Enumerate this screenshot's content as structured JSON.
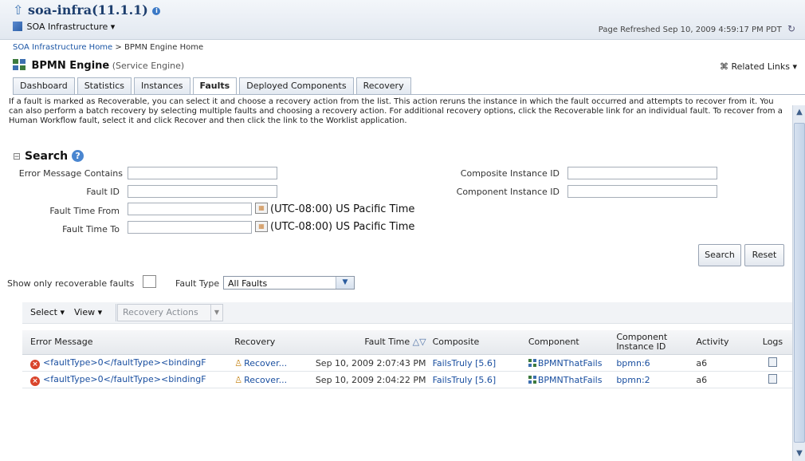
{
  "header": {
    "title": "soa-infra(11.1.1)",
    "menu_label": "SOA Infrastructure",
    "refreshed": "Page Refreshed Sep 10, 2009 4:59:17 PM PDT"
  },
  "breadcrumb": {
    "home": "SOA Infrastructure Home",
    "separator": ">",
    "current": "BPMN Engine Home"
  },
  "engine": {
    "name": "BPMN Engine",
    "type": "(Service Engine)",
    "related_links": "Related Links"
  },
  "tabs": [
    {
      "label": "Dashboard"
    },
    {
      "label": "Statistics"
    },
    {
      "label": "Instances"
    },
    {
      "label": "Faults"
    },
    {
      "label": "Deployed Components"
    },
    {
      "label": "Recovery"
    }
  ],
  "description": "If a fault is marked as Recoverable, you can select it and choose a recovery action from the list. This action reruns the instance in which the fault occurred and attempts to recover from it. You can also perform a batch recovery by selecting multiple faults and choosing a recovery action. For additional recovery options, click the Recoverable link for an individual fault. To recover from a Human Workflow fault, select it and click Recover and then click the link to the Worklist application.",
  "search": {
    "title": "Search",
    "error_message_label": "Error Message Contains",
    "fault_id_label": "Fault ID",
    "fault_time_from_label": "Fault Time From",
    "fault_time_to_label": "Fault Time To",
    "timezone": "(UTC-08:00) US Pacific Time",
    "composite_instance_label": "Composite Instance ID",
    "component_instance_label": "Component Instance ID",
    "search_button": "Search",
    "reset_button": "Reset"
  },
  "filters": {
    "recoverable_label": "Show only recoverable faults",
    "fault_type_label": "Fault Type",
    "fault_type_value": "All Faults"
  },
  "toolbar": {
    "select": "Select",
    "view": "View",
    "recovery_actions": "Recovery Actions"
  },
  "table": {
    "columns": [
      "Error Message",
      "Recovery",
      "Fault Time",
      "Composite",
      "Component",
      "Component Instance ID",
      "Activity",
      "Logs"
    ],
    "rows": [
      {
        "error": "<faultType>0</faultType><bindingF",
        "recovery": "Recover...",
        "time": "Sep 10, 2009 2:07:43 PM",
        "composite": "FailsTruly [5.6]",
        "component": "BPMNThatFails",
        "instance": "bpmn:6",
        "activity": "a6"
      },
      {
        "error": "<faultType>0</faultType><bindingF",
        "recovery": "Recover...",
        "time": "Sep 10, 2009 2:04:22 PM",
        "composite": "FailsTruly [5.6]",
        "component": "BPMNThatFails",
        "instance": "bpmn:2",
        "activity": "a6"
      }
    ]
  }
}
